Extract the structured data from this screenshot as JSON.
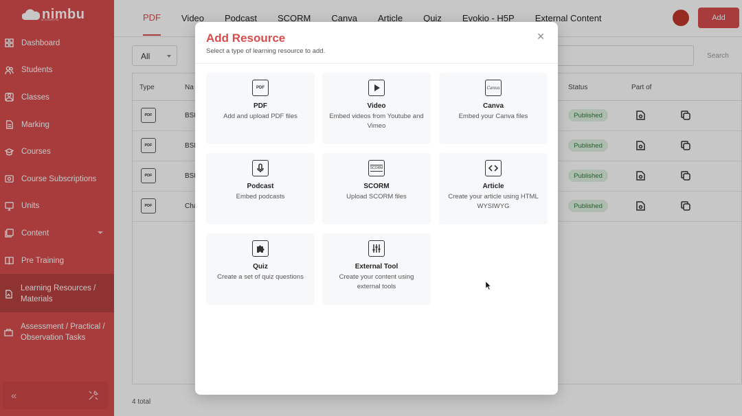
{
  "app": {
    "logo_text": "nimbu",
    "logo_sub": "an eLearn Pro"
  },
  "sidebar": {
    "items": [
      {
        "label": "Dashboard",
        "icon": "grid-icon"
      },
      {
        "label": "Students",
        "icon": "users-icon"
      },
      {
        "label": "Classes",
        "icon": "class-icon"
      },
      {
        "label": "Marking",
        "icon": "document-icon"
      },
      {
        "label": "Courses",
        "icon": "graduation-cap-icon"
      },
      {
        "label": "Course Subscriptions",
        "icon": "subscription-icon"
      },
      {
        "label": "Units",
        "icon": "monitor-icon"
      },
      {
        "label": "Content",
        "icon": "content-icon"
      },
      {
        "label": "Pre Training",
        "icon": "book-icon"
      },
      {
        "label": "Learning Resources / Materials",
        "icon": "file-icon"
      },
      {
        "label": "Assessment / Practical / Observation Tasks",
        "icon": "folder-icon"
      }
    ],
    "collapse_symbol": "«"
  },
  "topbar": {
    "tabs": [
      "PDF",
      "Video",
      "Podcast",
      "SCORM",
      "Canva",
      "Article",
      "Quiz",
      "Evokio - H5P",
      "External Content"
    ],
    "active_tab": "PDF",
    "add_label": "Add"
  },
  "filters": {
    "type_value": "All",
    "search_label": "Search"
  },
  "table": {
    "headers": [
      "Type",
      "Na",
      "Status",
      "Part of"
    ],
    "rows": [
      {
        "type": "PDF",
        "name": "BSB",
        "status": "Published"
      },
      {
        "type": "PDF",
        "name": "BSB",
        "status": "Published"
      },
      {
        "type": "PDF",
        "name": "BSB",
        "status": "Published"
      },
      {
        "type": "PDF",
        "name": "Cha",
        "status": "Published"
      }
    ],
    "total": "4 total"
  },
  "modal": {
    "title": "Add Resource",
    "subtitle": "Select a type of learning resource to add.",
    "close_symbol": "×",
    "cards": [
      {
        "title": "PDF",
        "desc": "Add and upload PDF files",
        "icon": "pdf-icon",
        "icon_text": "PDF"
      },
      {
        "title": "Video",
        "desc": "Embed videos from Youtube and Vimeo",
        "icon": "video-icon"
      },
      {
        "title": "Canva",
        "desc": "Embed your Canva files",
        "icon": "canva-icon",
        "icon_text": "Canva"
      },
      {
        "title": "Podcast",
        "desc": "Embed podcasts",
        "icon": "microphone-icon"
      },
      {
        "title": "SCORM",
        "desc": "Upload SCORM files",
        "icon": "scorm-icon",
        "icon_text": "SCORM"
      },
      {
        "title": "Article",
        "desc": "Create your article using HTML WYSIWYG",
        "icon": "code-icon"
      },
      {
        "title": "Quiz",
        "desc": "Create a set of quiz questions",
        "icon": "puzzle-icon"
      },
      {
        "title": "External Tool",
        "desc": "Create your content using external tools",
        "icon": "sliders-icon"
      }
    ]
  },
  "colors": {
    "brand": "#d84c4c",
    "published_bg": "#dff1e1",
    "published_text": "#2f7a3b"
  }
}
